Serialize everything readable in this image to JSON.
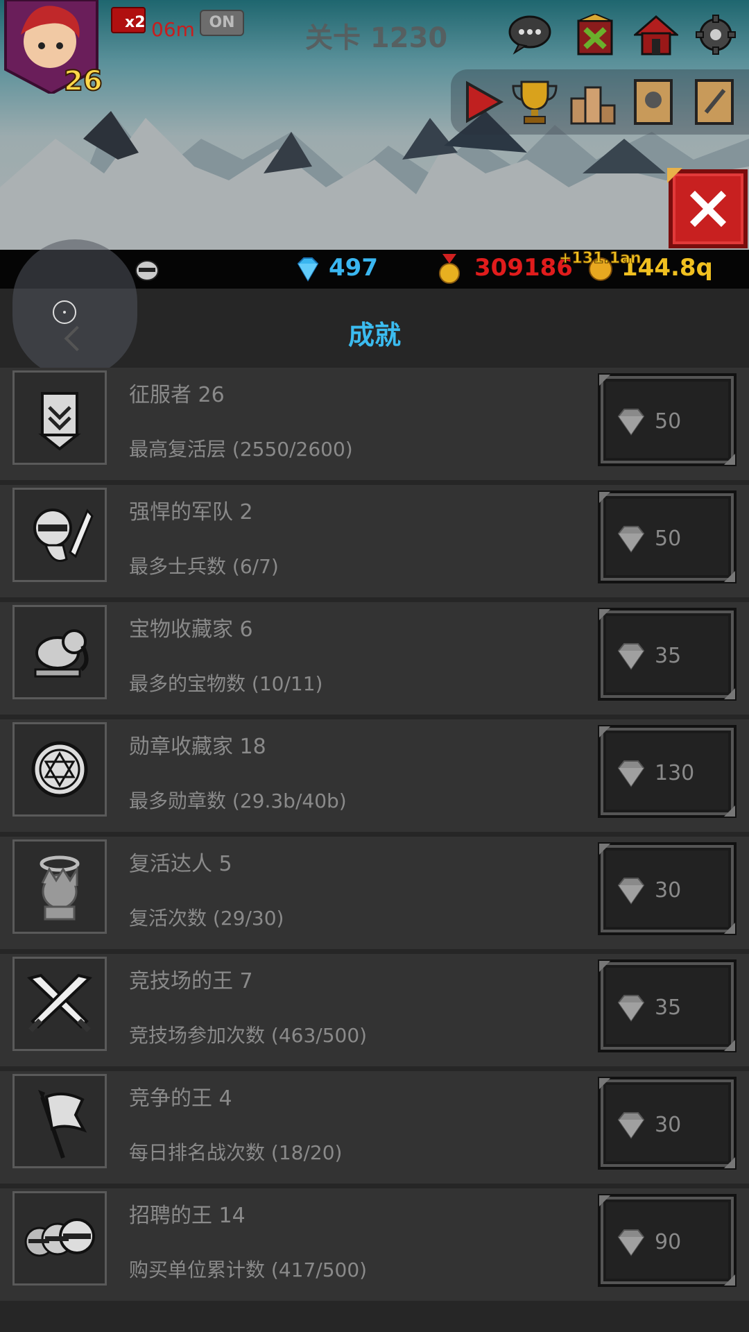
{
  "hud": {
    "level": "26",
    "speed": "x2",
    "timer": "06m",
    "toggle": "ON",
    "stage": "关卡 1230"
  },
  "resources": {
    "diamonds": "497",
    "medals": "309186",
    "gold": "144.8q",
    "gold_overlay": "+131.1an",
    "colors": {
      "diamonds": "#3ab6f0",
      "medals": "#e01c1c",
      "gold": "#f0c020"
    }
  },
  "icons_top": [
    "chat-icon",
    "guild-icon",
    "home-icon",
    "settings-icon"
  ],
  "icons_bar": [
    "play-icon",
    "trophy-icon",
    "ranking-icon",
    "book-icon",
    "scroll-icon"
  ],
  "page_title": "成就",
  "achievements": [
    {
      "name": "征服者 26",
      "desc": "最高复活层 (2550/2600)",
      "reward": "50",
      "icon": "banner-icon"
    },
    {
      "name": "强悍的军队 2",
      "desc": "最多士兵数 (6/7)",
      "reward": "50",
      "icon": "knight-icon"
    },
    {
      "name": "宝物收藏家 6",
      "desc": "最多的宝物数 (10/11)",
      "reward": "35",
      "icon": "elephant-icon"
    },
    {
      "name": "勋章收藏家 18",
      "desc": "最多勋章数 (29.3b/40b)",
      "reward": "130",
      "icon": "medal-icon"
    },
    {
      "name": "复活达人 5",
      "desc": "复活次数 (29/30)",
      "reward": "30",
      "icon": "angel-icon"
    },
    {
      "name": "竞技场的王 7",
      "desc": "竞技场参加次数 (463/500)",
      "reward": "35",
      "icon": "crossed-swords-icon"
    },
    {
      "name": "竞争的王 4",
      "desc": "每日排名战次数 (18/20)",
      "reward": "30",
      "icon": "flag-icon"
    },
    {
      "name": "招聘的王 14",
      "desc": "购买单位累计数 (417/500)",
      "reward": "90",
      "icon": "soldiers-icon"
    }
  ]
}
